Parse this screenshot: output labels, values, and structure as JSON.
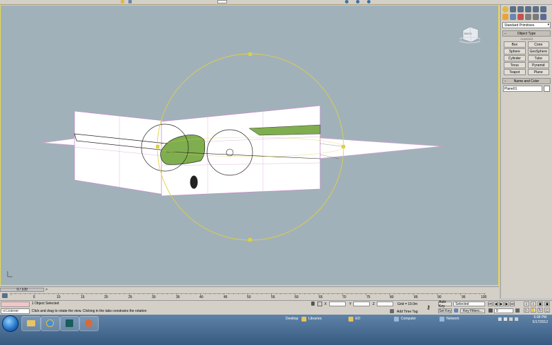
{
  "viewcube": {
    "label": "BACK"
  },
  "command_panel": {
    "category": "Standard Primitives",
    "object_type_title": "Object Type",
    "autogrid_label": "AutoGrid",
    "buttons": [
      "Box",
      "Cone",
      "Sphere",
      "GeoSphere",
      "Cylinder",
      "Tube",
      "Torus",
      "Pyramid",
      "Teapot",
      "Plane"
    ],
    "name_color_title": "Name and Color",
    "object_name": "Plane01"
  },
  "timeline": {
    "frame_indicator": "0 / 100",
    "ticks": [
      "5",
      "10",
      "15",
      "20",
      "25",
      "30",
      "35",
      "40",
      "45",
      "50",
      "55",
      "60",
      "65",
      "70",
      "75",
      "80",
      "85",
      "90",
      "95",
      "100"
    ]
  },
  "status": {
    "listener": "ni Listener",
    "selection": "1 Object Selected",
    "prompt": "Click and drag to rotate the view.  Clicking in the tabs constrains the rotation",
    "x_label": "X",
    "y_label": "Y",
    "z_label": "Z",
    "grid": "Grid = 10.0m",
    "auto_key": "Auto Key",
    "set_key": "Set Key",
    "selected": "Selected",
    "key_filters": "Key Filters...",
    "add_time_tag": "Add Time Tag",
    "frame_field": "0"
  },
  "taskbar": {
    "desktop": "Desktop",
    "libraries": "Libraries",
    "ed": "ED",
    "computer": "Computer",
    "network": "Network",
    "time": "6:08 PM",
    "date": "5/17/2012"
  },
  "colors": {
    "viewport_bg": "#a1b1ba",
    "wing_green": "#7fae4e",
    "selection_ring": "#e0d040",
    "plane_edges": "#c890c8"
  }
}
